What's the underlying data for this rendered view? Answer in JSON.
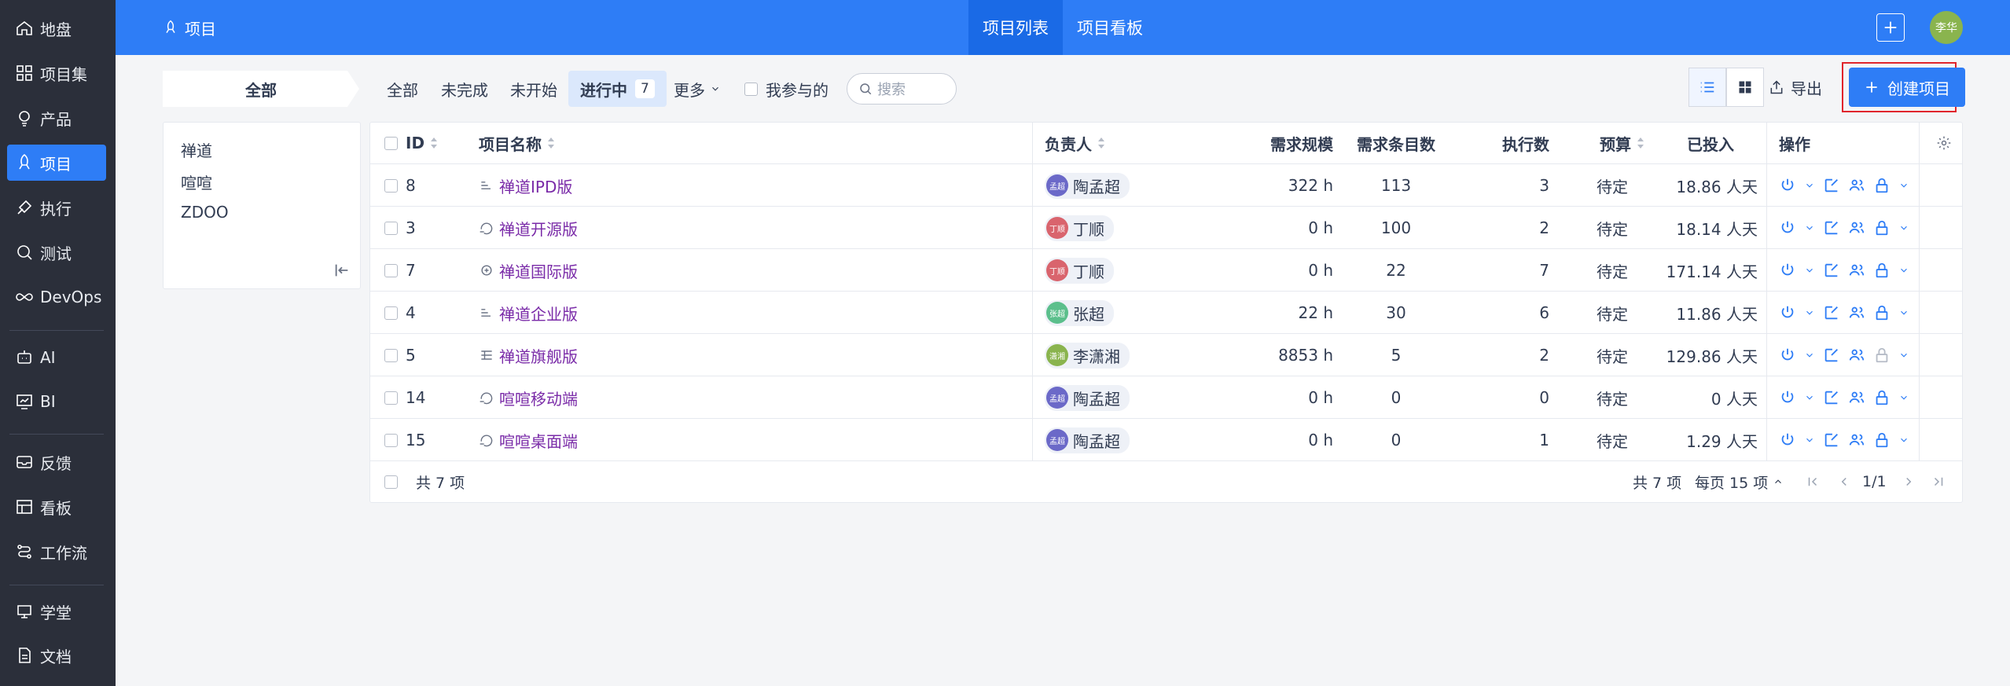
{
  "sidebar": {
    "items": [
      {
        "label": "地盘",
        "icon": "home-icon"
      },
      {
        "label": "项目集",
        "icon": "grid-icon"
      },
      {
        "label": "产品",
        "icon": "bulb-icon"
      },
      {
        "label": "项目",
        "icon": "rocket-icon",
        "active": true
      },
      {
        "label": "执行",
        "icon": "run-icon"
      },
      {
        "label": "测试",
        "icon": "search-icon"
      },
      {
        "label": "DevOps",
        "icon": "infinity-icon"
      },
      {
        "label": "AI",
        "icon": "robot-icon"
      },
      {
        "label": "BI",
        "icon": "chart-icon"
      },
      {
        "label": "反馈",
        "icon": "feedback-icon"
      },
      {
        "label": "看板",
        "icon": "board-icon"
      },
      {
        "label": "工作流",
        "icon": "flow-icon"
      },
      {
        "label": "学堂",
        "icon": "school-icon"
      },
      {
        "label": "文档",
        "icon": "doc-icon"
      }
    ]
  },
  "topbar": {
    "title": "项目",
    "tabs": [
      {
        "label": "项目列表",
        "active": true
      },
      {
        "label": "项目看板",
        "active": false
      }
    ],
    "avatar": "李华",
    "accent": "#2e7df6"
  },
  "filters": {
    "all_tab": "全部",
    "items": [
      "全部",
      "未完成",
      "未开始"
    ],
    "active": {
      "label": "进行中",
      "count": "7"
    },
    "more": "更多",
    "mine": "我参与的",
    "search_placeholder": "搜索",
    "export": "导出",
    "create": "创建项目"
  },
  "tree": {
    "items": [
      "禅道",
      "喧喧",
      "ZDOO"
    ]
  },
  "table": {
    "headers": {
      "id": "ID",
      "name": "项目名称",
      "pm": "负责人",
      "scale": "需求规模",
      "stories": "需求条目数",
      "execs": "执行数",
      "budget": "预算",
      "consumed": "已投入",
      "actions": "操作"
    },
    "rows": [
      {
        "id": "8",
        "name": "禅道IPD版",
        "pm": "陶孟超",
        "pm_short": "孟超",
        "pm_color": "#6b69c8",
        "scale": "322 h",
        "stories": "113",
        "execs": "3",
        "budget": "待定",
        "consumed": "18.86 人天",
        "icon": "waterfall-icon"
      },
      {
        "id": "3",
        "name": "禅道开源版",
        "pm": "丁顺",
        "pm_short": "丁顺",
        "pm_color": "#d9646d",
        "scale": "0 h",
        "stories": "100",
        "execs": "2",
        "budget": "待定",
        "consumed": "18.14 人天",
        "icon": "scrum-icon"
      },
      {
        "id": "7",
        "name": "禅道国际版",
        "pm": "丁顺",
        "pm_short": "丁顺",
        "pm_color": "#d9646d",
        "scale": "0 h",
        "stories": "22",
        "execs": "7",
        "budget": "待定",
        "consumed": "171.14 人天",
        "icon": "agile-icon"
      },
      {
        "id": "4",
        "name": "禅道企业版",
        "pm": "张超",
        "pm_short": "张超",
        "pm_color": "#5bbf8c",
        "scale": "22 h",
        "stories": "30",
        "execs": "6",
        "budget": "待定",
        "consumed": "11.86 人天",
        "icon": "waterfall-icon"
      },
      {
        "id": "5",
        "name": "禅道旗舰版",
        "pm": "李潇湘",
        "pm_short": "潇湘",
        "pm_color": "#8ab44e",
        "scale": "8853 h",
        "stories": "5",
        "execs": "2",
        "budget": "待定",
        "consumed": "129.86 人天",
        "icon": "kanban-icon"
      },
      {
        "id": "14",
        "name": "喧喧移动端",
        "pm": "陶孟超",
        "pm_short": "孟超",
        "pm_color": "#6b69c8",
        "scale": "0 h",
        "stories": "0",
        "execs": "0",
        "budget": "待定",
        "consumed": "0 人天",
        "icon": "scrum-icon"
      },
      {
        "id": "15",
        "name": "喧喧桌面端",
        "pm": "陶孟超",
        "pm_short": "孟超",
        "pm_color": "#6b69c8",
        "scale": "0 h",
        "stories": "0",
        "execs": "1",
        "budget": "待定",
        "consumed": "1.29 人天",
        "icon": "scrum-icon"
      }
    ],
    "footer": {
      "count": "共 7 项",
      "total": "共 7 项",
      "per_page": "每页 15 项",
      "page": "1/1"
    }
  }
}
